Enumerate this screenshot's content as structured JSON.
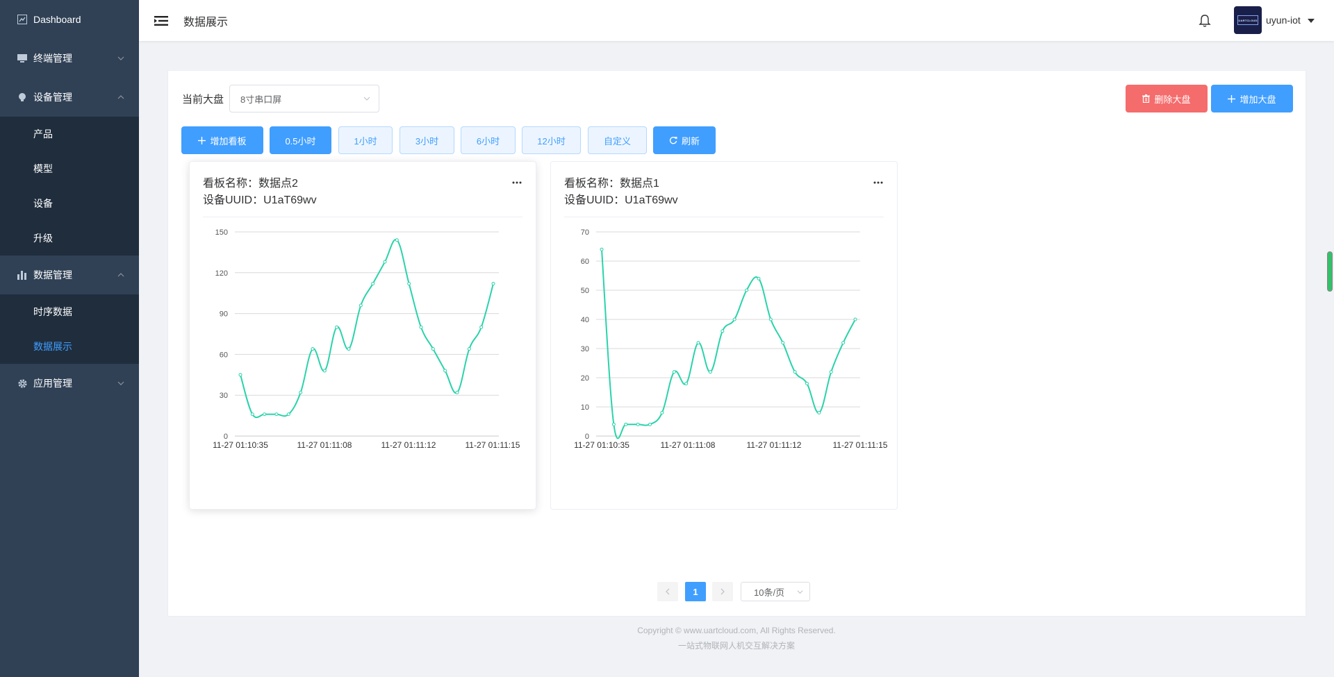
{
  "sidebar": {
    "dashboard": "Dashboard",
    "terminal_mgmt": "终端管理",
    "device_mgmt": "设备管理",
    "device_sub": [
      "产品",
      "模型",
      "设备",
      "升级"
    ],
    "data_mgmt": "数据管理",
    "data_sub": [
      "时序数据",
      "数据展示"
    ],
    "app_mgmt": "应用管理",
    "active_color": "#409eff"
  },
  "header": {
    "title": "数据展示",
    "username": "uyun-iot",
    "avatar_text": "UARTCLOUD"
  },
  "toolbar": {
    "current_board_label": "当前大盘",
    "board_select_value": "8寸串口屏",
    "delete_board": "删除大盘",
    "add_board": "增加大盘",
    "add_panel": "增加看板",
    "ranges": [
      "0.5小时",
      "1小时",
      "3小时",
      "6小时",
      "12小时",
      "自定义"
    ],
    "active_range": "0.5小时",
    "refresh": "刷新"
  },
  "panels": [
    {
      "name_line": "看板名称：数据点2",
      "uuid_line": "设备UUID：U1aT69wv"
    },
    {
      "name_line": "看板名称：数据点1",
      "uuid_line": "设备UUID：U1aT69wv"
    }
  ],
  "chart_data": [
    {
      "type": "line",
      "x_tick_labels": [
        "11-27 01:10:35",
        "11-27 01:11:08",
        "11-27 01:11:12",
        "11-27 01:11:15"
      ],
      "y_ticks": [
        0,
        30,
        60,
        90,
        120,
        150
      ],
      "ylim": [
        0,
        150
      ],
      "grid": true,
      "series": [
        {
          "color": "#29d3aa",
          "values": [
            45,
            16,
            16,
            16,
            16,
            32,
            64,
            48,
            80,
            64,
            96,
            112,
            128,
            144,
            112,
            80,
            64,
            48,
            32,
            64,
            80,
            112
          ]
        }
      ]
    },
    {
      "type": "line",
      "x_tick_labels": [
        "11-27 01:10:35",
        "11-27 01:11:08",
        "11-27 01:11:12",
        "11-27 01:11:15"
      ],
      "y_ticks": [
        0,
        10,
        20,
        30,
        40,
        50,
        60,
        70
      ],
      "ylim": [
        0,
        70
      ],
      "grid": true,
      "series": [
        {
          "color": "#29d3aa",
          "values": [
            64,
            4,
            4,
            4,
            4,
            8,
            22,
            18,
            32,
            22,
            36,
            40,
            50,
            54,
            40,
            32,
            22,
            18,
            8,
            22,
            32,
            40
          ]
        }
      ]
    }
  ],
  "pagination": {
    "current_page": "1",
    "page_size": "10条/页"
  },
  "footer": {
    "copyright": "Copyright © www.uartcloud.com, All Rights Reserved.",
    "slogan": "一站式物联网人机交互解决方案"
  }
}
